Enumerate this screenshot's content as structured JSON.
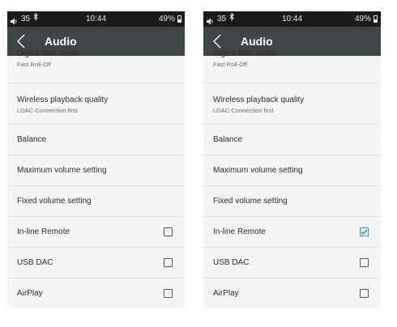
{
  "status": {
    "left": "35",
    "time": "10:44",
    "battery": "49%"
  },
  "title": "Audio",
  "rows": [
    {
      "label": "Digital filter mode",
      "sub": "Fast Roll-Off"
    },
    {
      "label": "Wireless playback quality",
      "sub": "LDAC-Connection first"
    },
    {
      "label": "Balance"
    },
    {
      "label": "Maximum volume setting"
    },
    {
      "label": "Fixed volume setting"
    },
    {
      "label": "In-line Remote"
    },
    {
      "label": "USB DAC"
    },
    {
      "label": "AirPlay"
    }
  ],
  "screens": [
    {
      "checks": {
        "inline_remote": false,
        "usb_dac": false,
        "airplay": false
      }
    },
    {
      "checks": {
        "inline_remote": true,
        "usb_dac": false,
        "airplay": false
      }
    }
  ],
  "colors": {
    "check_accent": "#1aa2a0",
    "appbar": "#3f4648",
    "statusbar": "#1b1b1b"
  }
}
